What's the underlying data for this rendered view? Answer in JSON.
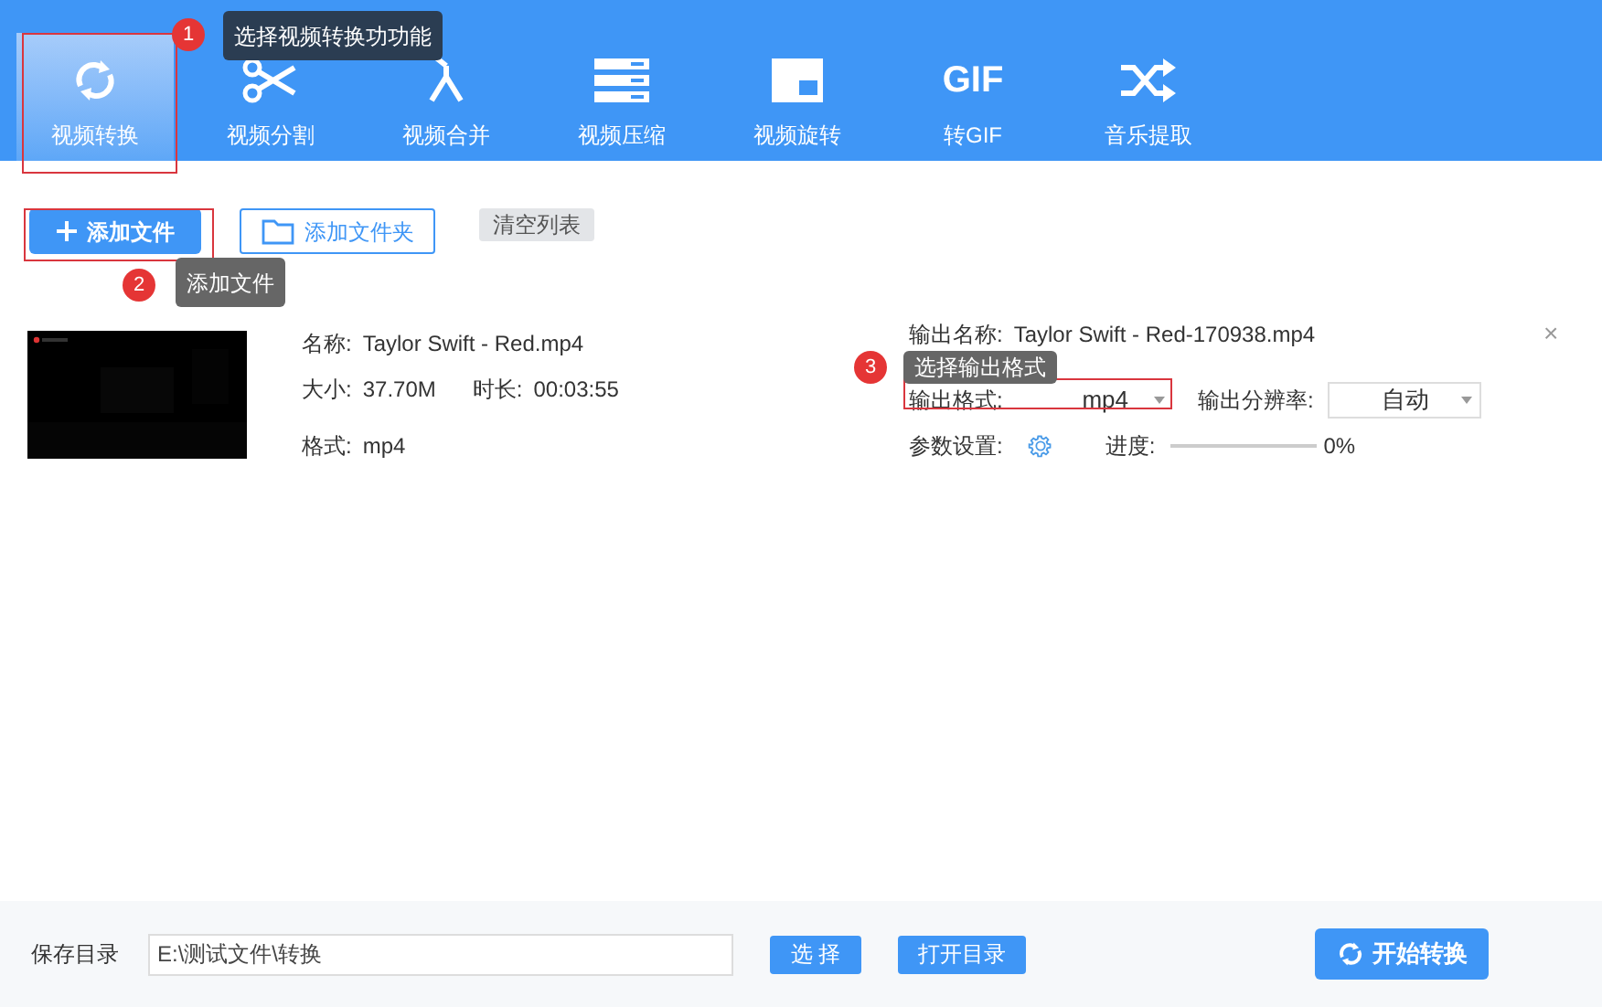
{
  "toolbar": {
    "tabs": [
      {
        "label": "视频转换",
        "selected": true
      },
      {
        "label": "视频分割",
        "selected": false
      },
      {
        "label": "视频合并",
        "selected": false
      },
      {
        "label": "视频压缩",
        "selected": false
      },
      {
        "label": "视频旋转",
        "selected": false
      },
      {
        "label": "转GIF",
        "icon_text": "GIF",
        "selected": false
      },
      {
        "label": "音乐提取",
        "selected": false
      }
    ]
  },
  "actions": {
    "add_file": "添加文件",
    "add_folder": "添加文件夹",
    "clear_list": "清空列表"
  },
  "file": {
    "name_label": "名称:",
    "name": "Taylor Swift - Red.mp4",
    "size_label": "大小:",
    "size": "37.70M",
    "duration_label": "时长:",
    "duration": "00:03:55",
    "format_label": "格式:",
    "format": "mp4",
    "output_name_label": "输出名称:",
    "output_name": "Taylor Swift - Red-170938.mp4",
    "output_format_label": "输出格式:",
    "output_format": "mp4",
    "resolution_label": "输出分辨率:",
    "resolution": "自动",
    "params_label": "参数设置:",
    "progress_label": "进度:",
    "progress": {
      "level": 0,
      "text": "0%"
    },
    "close": "×"
  },
  "annotations": [
    {
      "number": "1",
      "text": "选择视频转换功功能",
      "kind": "dark"
    },
    {
      "number": "2",
      "text": "添加文件",
      "kind": "gray"
    },
    {
      "number": "3",
      "text": "选择输出格式",
      "kind": "gray"
    }
  ],
  "footer": {
    "save_dir_label": "保存目录",
    "path": "E:\\测试文件\\转换",
    "choose": "选 择",
    "open_dir": "打开目录",
    "start": "开始转换"
  }
}
